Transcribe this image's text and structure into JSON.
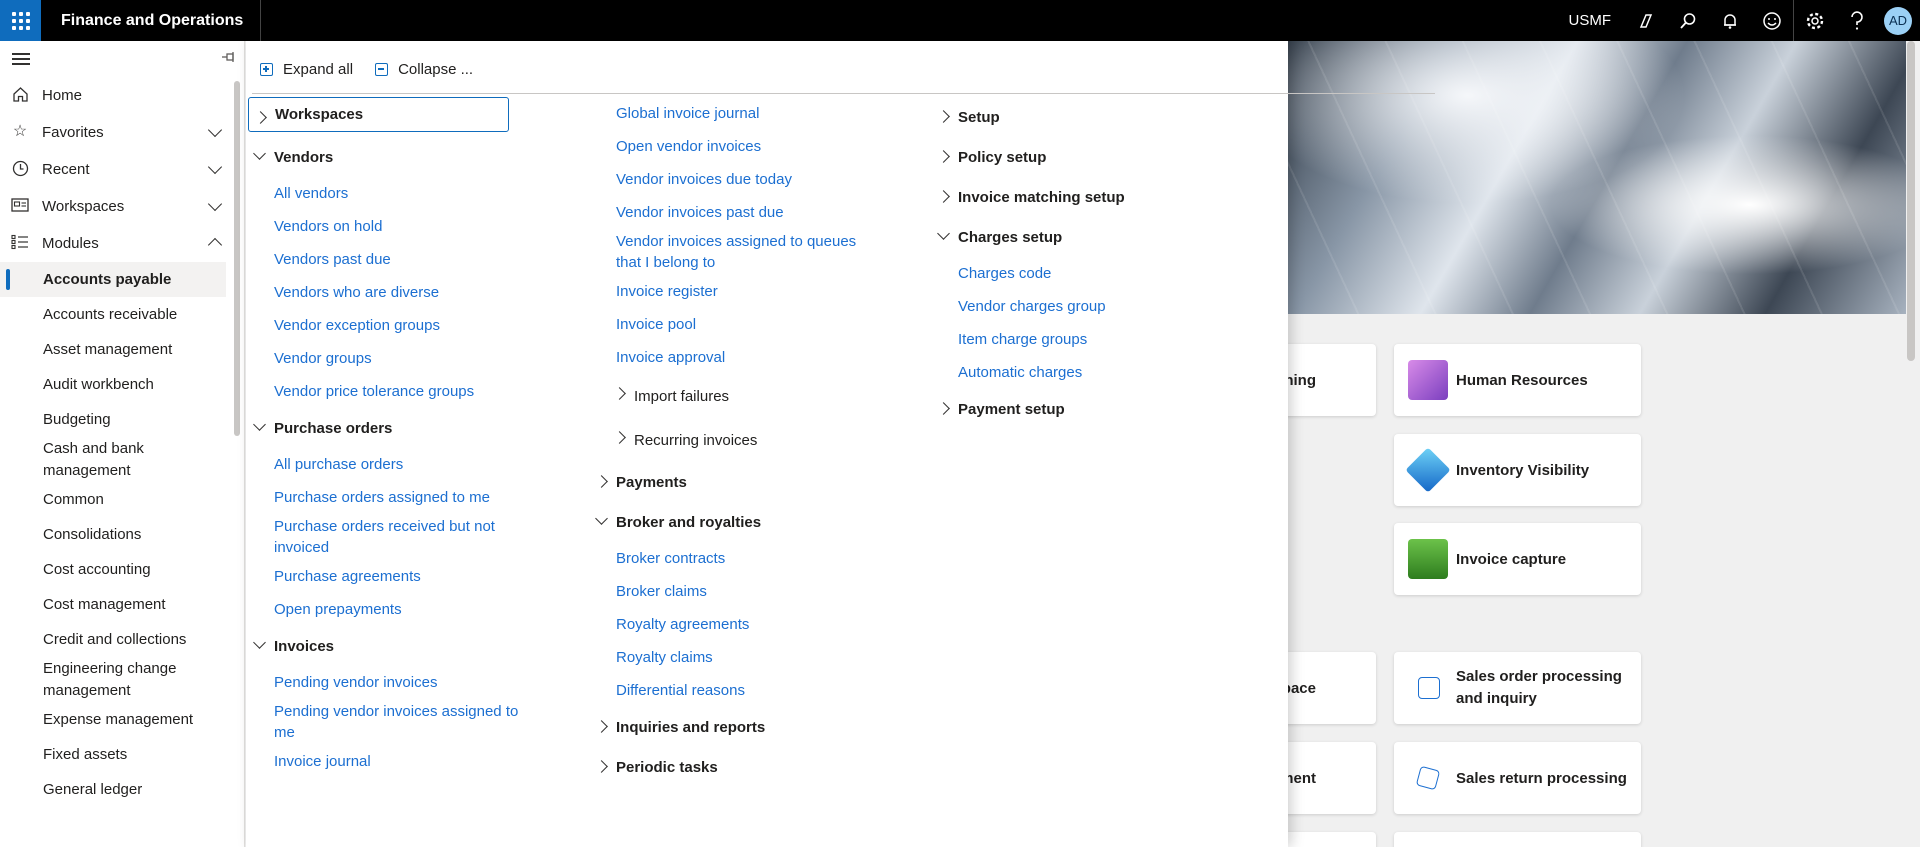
{
  "topbar": {
    "app_title": "Finance and Operations",
    "company": "USMF",
    "avatar_initials": "AD",
    "icons": [
      "waffle-icon",
      "copilot-icon",
      "search-icon",
      "bell-icon",
      "smiley-icon",
      "gear-icon",
      "help-icon"
    ]
  },
  "leftnav": {
    "items": [
      {
        "label": "Home",
        "icon": "home-icon"
      },
      {
        "label": "Favorites",
        "icon": "star-icon"
      },
      {
        "label": "Recent",
        "icon": "clock-icon"
      },
      {
        "label": "Workspaces",
        "icon": "workspace-icon"
      },
      {
        "label": "Modules",
        "icon": "list-icon"
      }
    ],
    "modules": [
      "Accounts payable",
      "Accounts receivable",
      "Asset management",
      "Audit workbench",
      "Budgeting",
      "Cash and bank management",
      "Common",
      "Consolidations",
      "Cost accounting",
      "Cost management",
      "Credit and collections",
      "Engineering change management",
      "Expense management",
      "Fixed assets",
      "General ledger"
    ],
    "selected_module": "Accounts payable"
  },
  "flyout": {
    "toolbar": {
      "expand_all": "Expand all",
      "collapse_all": "Collapse ..."
    },
    "col1": {
      "workspaces": "Workspaces",
      "vendors": {
        "title": "Vendors",
        "links": [
          "All vendors",
          "Vendors on hold",
          "Vendors past due",
          "Vendors who are diverse",
          "Vendor exception groups",
          "Vendor groups",
          "Vendor price tolerance groups"
        ]
      },
      "purchase_orders": {
        "title": "Purchase orders",
        "links": [
          "All purchase orders",
          "Purchase orders assigned to me",
          "Purchase orders received but not invoiced",
          "Purchase agreements",
          "Open prepayments"
        ]
      },
      "invoices": {
        "title": "Invoices",
        "links": [
          "Pending vendor invoices",
          "Pending vendor invoices assigned to me",
          "Invoice journal"
        ]
      }
    },
    "col2": {
      "links": [
        "Global invoice journal",
        "Open vendor invoices",
        "Vendor invoices due today",
        "Vendor invoices past due",
        "Vendor invoices assigned to queues that I belong to",
        "Invoice register",
        "Invoice pool",
        "Invoice approval"
      ],
      "import_failures": "Import failures",
      "recurring_invoices": "Recurring invoices",
      "payments": "Payments",
      "broker": {
        "title": "Broker and royalties",
        "links": [
          "Broker contracts",
          "Broker claims",
          "Royalty agreements",
          "Royalty claims",
          "Differential reasons"
        ]
      },
      "inquiries": "Inquiries and reports",
      "periodic": "Periodic tasks"
    },
    "col3": {
      "setup": "Setup",
      "policy_setup": "Policy setup",
      "invoice_matching_setup": "Invoice matching setup",
      "charges": {
        "title": "Charges setup",
        "links": [
          "Charges code",
          "Vendor charges group",
          "Item charge groups",
          "Automatic charges"
        ]
      },
      "payment_setup": "Payment setup"
    }
  },
  "workspace": {
    "tiles": [
      "ning",
      "Human Resources",
      "Inventory Visibility",
      "Invoice capture",
      "space",
      "Sales order processing and inquiry",
      "ement",
      "Sales return processing"
    ]
  }
}
